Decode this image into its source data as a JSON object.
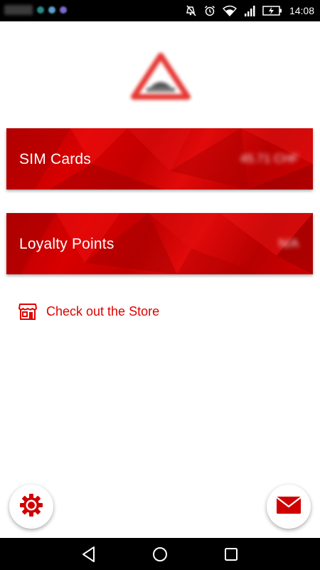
{
  "status_bar": {
    "time": "14:08",
    "icons": [
      "mute-icon",
      "alarm-icon",
      "wifi-icon",
      "signal-icon",
      "battery-charging-icon"
    ],
    "notification_colors": [
      "#2a8a8a",
      "#7a6ad0",
      "#5aa0d0"
    ]
  },
  "logo": {
    "icon": "warning-triangle-logo"
  },
  "cards": [
    {
      "label": "SIM Cards",
      "value": "45.71 CHF"
    },
    {
      "label": "Loyalty Points",
      "value": "N/A"
    }
  ],
  "store_link": {
    "label": "Check out the Store",
    "icon": "store-icon"
  },
  "fabs": {
    "settings_icon": "gear-icon",
    "mail_icon": "mail-icon"
  },
  "nav": {
    "back": "back-icon",
    "home": "home-icon",
    "recents": "recents-icon"
  },
  "colors": {
    "accent": "#e00000",
    "card_red": "#cc0000",
    "bar": "#000000"
  }
}
